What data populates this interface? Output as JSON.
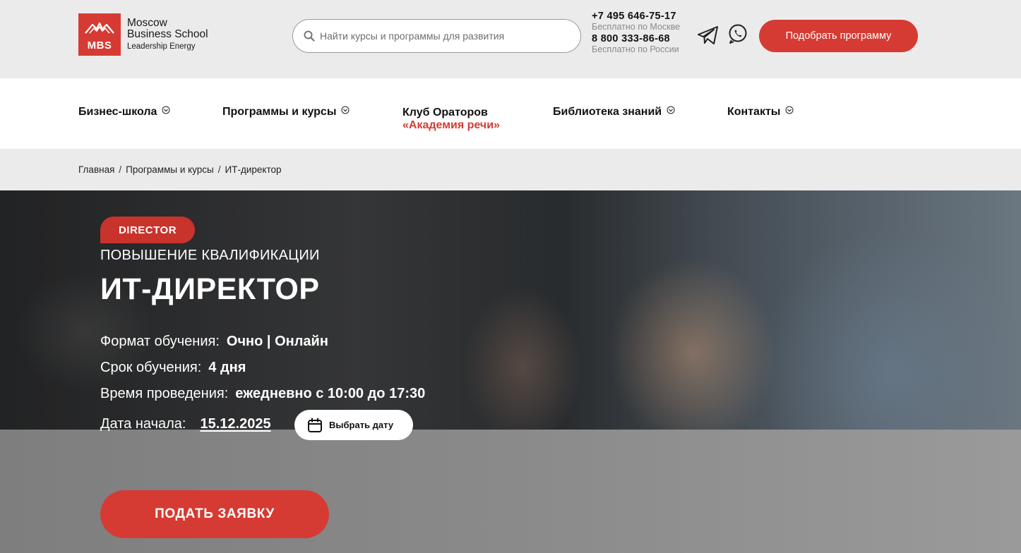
{
  "header": {
    "logo": {
      "abbr": "MBS",
      "line1": "Moscow",
      "line2": "Business School",
      "line3": "Leadership Energy"
    },
    "search": {
      "placeholder": "Найти курсы и программы для развития"
    },
    "phones": [
      {
        "number": "+7 495 646-75-17",
        "note": "Бесплатно по Москве"
      },
      {
        "number": "8 800 333-86-68",
        "note": "Бесплатно по России"
      }
    ],
    "messengers": [
      "telegram-icon",
      "whatsapp-icon"
    ],
    "cta_label": "Подобрать программу"
  },
  "nav": {
    "items": [
      {
        "label": "Бизнес-школа",
        "icon": "chevron-down-icon"
      },
      {
        "label": "Программы и курсы",
        "icon": "chevron-down-icon"
      },
      {
        "label": "Библиотека знаний",
        "icon": "chevron-down-icon"
      },
      {
        "label": "Контакты",
        "icon": "chevron-down-icon"
      }
    ],
    "club": {
      "line1": "Клуб Ораторов",
      "line2": "«Академия речи»"
    }
  },
  "breadcrumb": {
    "items": [
      "Главная",
      "Программы и курсы",
      "ИТ-директор"
    ],
    "separator": "/"
  },
  "hero": {
    "badge": "DIRECTOR",
    "subtitle": "ПОВЫШЕНИЕ КВАЛИФИКАЦИИ",
    "title": "ИТ-ДИРЕКТОР",
    "format": {
      "label": "Формат обучения:",
      "value": "Очно | Онлайн"
    },
    "duration": {
      "label": "Срок обучения:",
      "value": "4 дня"
    },
    "schedule": {
      "label": "Время проведения:",
      "value": "ежедневно с 10:00 до 17:30"
    },
    "start": {
      "label": "Дата начала:",
      "value": "15.12.2025"
    },
    "date_button": "Выбрать дату",
    "apply_button": "ПОДАТЬ ЗАЯВКУ"
  },
  "colors": {
    "accent": "#d63b33",
    "header_bg": "#ebebeb",
    "text": "#111111"
  }
}
